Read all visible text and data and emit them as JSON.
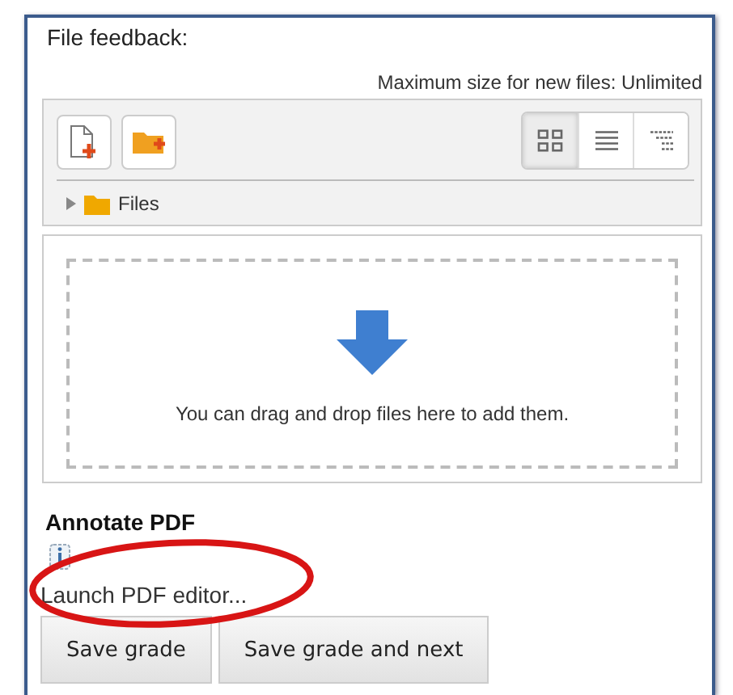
{
  "section": {
    "title": "File feedback:",
    "max_size": "Maximum size for new files: Unlimited"
  },
  "file_picker": {
    "views": [
      {
        "kind": "icons",
        "selected": true
      },
      {
        "kind": "list",
        "selected": false
      },
      {
        "kind": "tree",
        "selected": false
      }
    ],
    "folder": {
      "label": "Files",
      "expanded": false
    },
    "drop_hint": "You can drag and drop files here to add them."
  },
  "annotate": {
    "title": "Annotate PDF",
    "link": "Launch PDF editor..."
  },
  "buttons": [
    "Save grade",
    "Save grade and next"
  ]
}
